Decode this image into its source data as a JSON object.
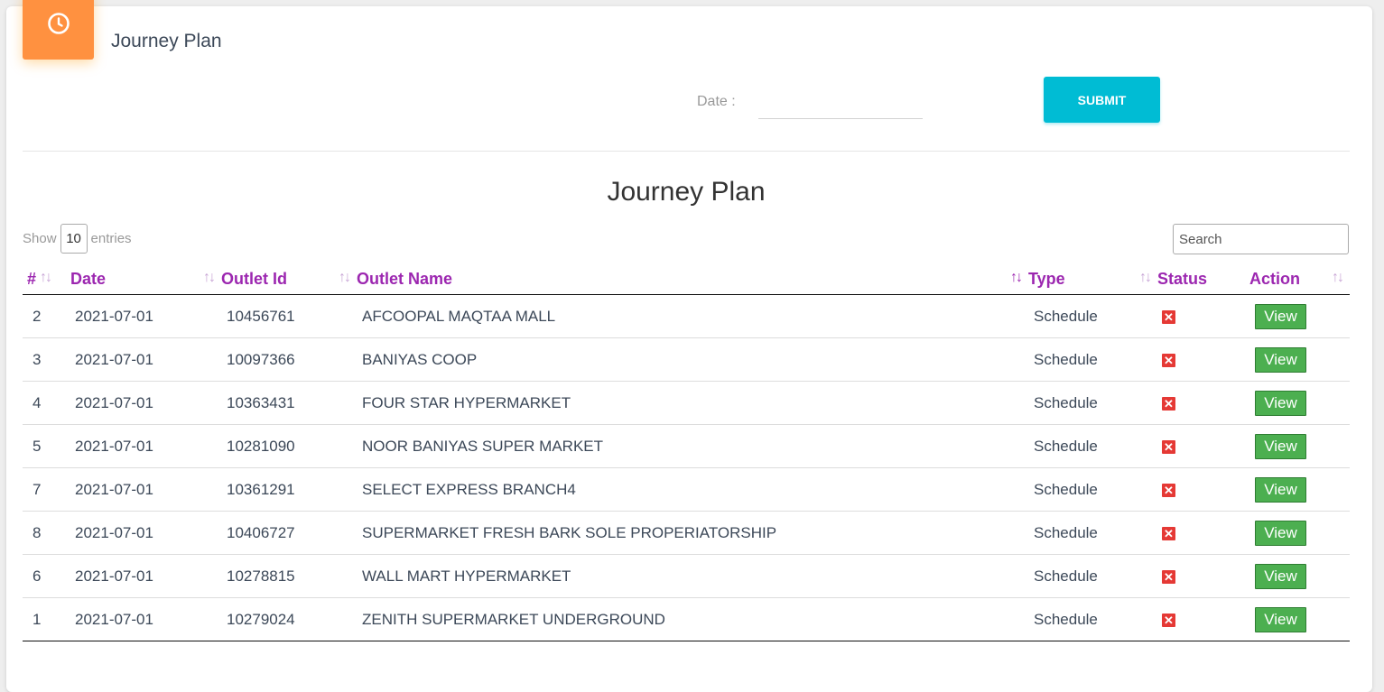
{
  "header": {
    "title": "Journey Plan",
    "icon": "clock-icon",
    "accent": "#ff9140"
  },
  "form": {
    "date_label": "Date :",
    "date_value": "",
    "submit_label": "SUBMIT"
  },
  "section": {
    "title": "Journey Plan"
  },
  "table_controls": {
    "show_label": "Show",
    "entries_value": "10",
    "entries_label": "entries",
    "search_placeholder": "Search"
  },
  "columns": [
    "#",
    "Date",
    "Outlet Id",
    "Outlet Name",
    "Type",
    "Status",
    "Action"
  ],
  "rows": [
    {
      "num": "2",
      "date": "2021-07-01",
      "outlet_id": "10456761",
      "outlet_name": "AFCOOPAL MAQTAA MALL",
      "type": "Schedule",
      "action": "View"
    },
    {
      "num": "3",
      "date": "2021-07-01",
      "outlet_id": "10097366",
      "outlet_name": "BANIYAS COOP",
      "type": "Schedule",
      "action": "View"
    },
    {
      "num": "4",
      "date": "2021-07-01",
      "outlet_id": "10363431",
      "outlet_name": "FOUR STAR HYPERMARKET",
      "type": "Schedule",
      "action": "View"
    },
    {
      "num": "5",
      "date": "2021-07-01",
      "outlet_id": "10281090",
      "outlet_name": "NOOR BANIYAS SUPER MARKET",
      "type": "Schedule",
      "action": "View"
    },
    {
      "num": "7",
      "date": "2021-07-01",
      "outlet_id": "10361291",
      "outlet_name": "SELECT EXPRESS BRANCH4",
      "type": "Schedule",
      "action": "View"
    },
    {
      "num": "8",
      "date": "2021-07-01",
      "outlet_id": "10406727",
      "outlet_name": "SUPERMARKET FRESH BARK SOLE PROPERIATORSHIP",
      "type": "Schedule",
      "action": "View"
    },
    {
      "num": "6",
      "date": "2021-07-01",
      "outlet_id": "10278815",
      "outlet_name": "WALL MART HYPERMARKET",
      "type": "Schedule",
      "action": "View"
    },
    {
      "num": "1",
      "date": "2021-07-01",
      "outlet_id": "10279024",
      "outlet_name": "ZENITH SUPERMARKET UNDERGROUND",
      "type": "Schedule",
      "action": "View"
    }
  ],
  "colors": {
    "heading": "#9c27b0",
    "submit": "#00bcd4",
    "view": "#4caf50",
    "status_x": "#e53935"
  }
}
